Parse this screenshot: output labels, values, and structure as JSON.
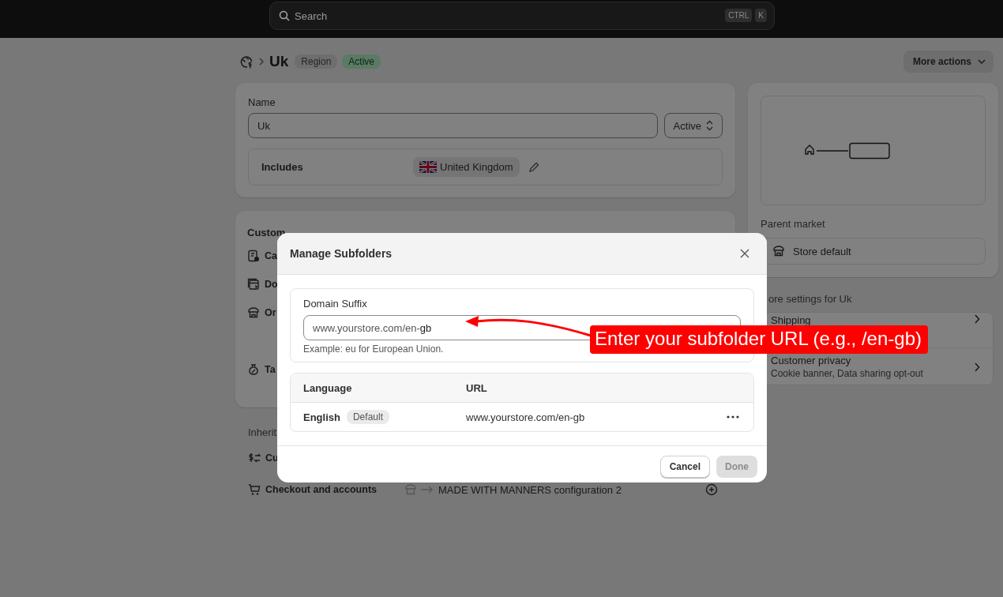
{
  "search": {
    "placeholder": "Search",
    "keys": [
      "CTRL",
      "K"
    ]
  },
  "header": {
    "title": "Uk",
    "badges": [
      {
        "label": "Region",
        "kind": "neutral"
      },
      {
        "label": "Active",
        "kind": "success"
      }
    ],
    "more_actions": "More actions"
  },
  "name_card": {
    "label": "Name",
    "value": "Uk",
    "status": "Active",
    "includes_label": "Includes",
    "countries": [
      "United Kingdom"
    ]
  },
  "customized": {
    "heading": "Custom",
    "items": [
      {
        "kind": "catalog",
        "label": "Ca"
      },
      {
        "kind": "domain",
        "label": "Do"
      },
      {
        "kind": "store",
        "label": "Or"
      },
      {
        "kind": "tax",
        "label": "Ta"
      }
    ]
  },
  "inherited": {
    "heading": "Inherit",
    "items": [
      {
        "kind": "currency",
        "label": "Cu"
      },
      {
        "kind": "cart",
        "label": "Checkout and accounts",
        "source": "MADE WITH MANNERS configuration 2"
      }
    ]
  },
  "parent_market": {
    "label": "Parent market",
    "value": "Store default"
  },
  "more_settings": {
    "heading": "ore settings for Uk",
    "items": [
      {
        "title": "Shipping"
      },
      {
        "title": "Customer privacy",
        "subtitle": "Cookie banner, Data sharing opt-out"
      }
    ]
  },
  "modal": {
    "title": "Manage Subfolders",
    "field_label": "Domain Suffix",
    "prefix": "www.yourstore.com/en-",
    "value": "gb",
    "helper": "Example: eu for European Union.",
    "columns": [
      "Language",
      "URL"
    ],
    "rows": [
      {
        "language": "English",
        "badge": "Default",
        "url": "www.yourstore.com/en-gb"
      }
    ],
    "buttons": [
      {
        "label": "Cancel",
        "disabled": false
      },
      {
        "label": "Done",
        "disabled": true
      }
    ]
  },
  "callout": {
    "text": "Enter your subfolder URL (e.g., /en-gb)"
  }
}
